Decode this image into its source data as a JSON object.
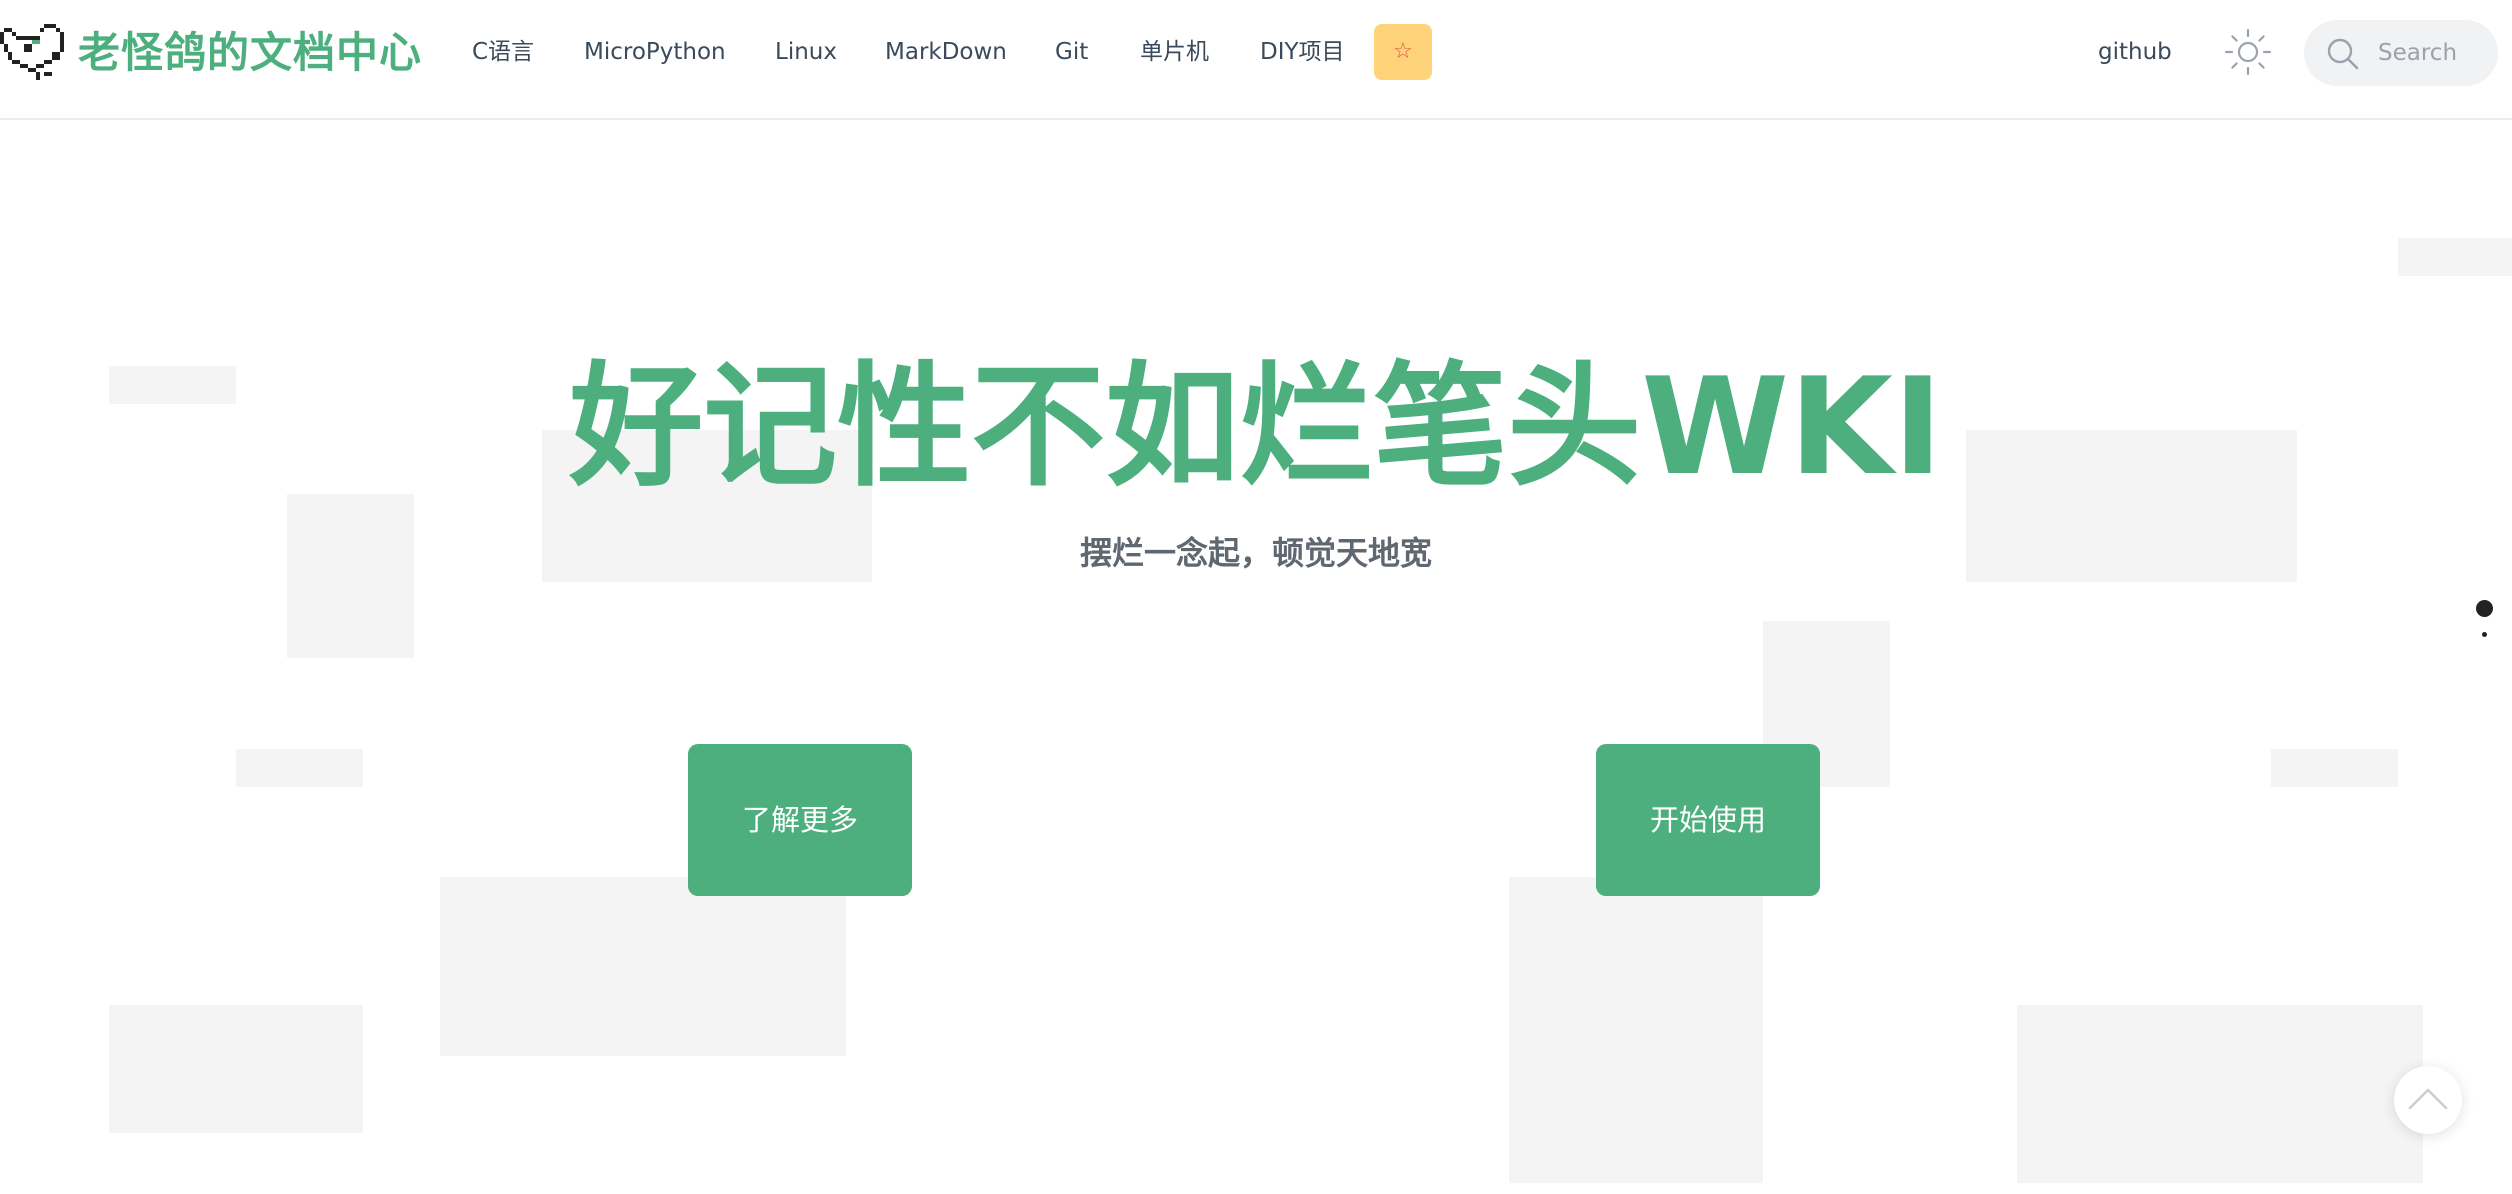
{
  "navbar": {
    "site_title": "老怪鸽的文档中心",
    "items": [
      {
        "label": "C语言"
      },
      {
        "label": "MicroPython"
      },
      {
        "label": "Linux"
      },
      {
        "label": "MarkDown"
      },
      {
        "label": "Git"
      },
      {
        "label": "单片机"
      },
      {
        "label": "DIY项目"
      }
    ],
    "star_label": "☆",
    "github_label": "github",
    "search": {
      "placeholder": "Search",
      "value": ""
    }
  },
  "hero": {
    "title": "好记性不如烂笔头WKI",
    "tagline": "摆烂一念起，顿觉天地宽",
    "primary_button": "了解更多",
    "secondary_button": "开始使用"
  },
  "icons": {
    "logo": "pixel-pigeon-icon",
    "theme_toggle": "sun-icon",
    "search": "search-icon",
    "back_to_top": "chevron-up-icon"
  },
  "colors": {
    "brand": "#4caf7d",
    "star_button_bg": "#ffd37a",
    "text": "#3a4a5a",
    "tagline": "#5f6770",
    "block": "#f4f4f4"
  }
}
